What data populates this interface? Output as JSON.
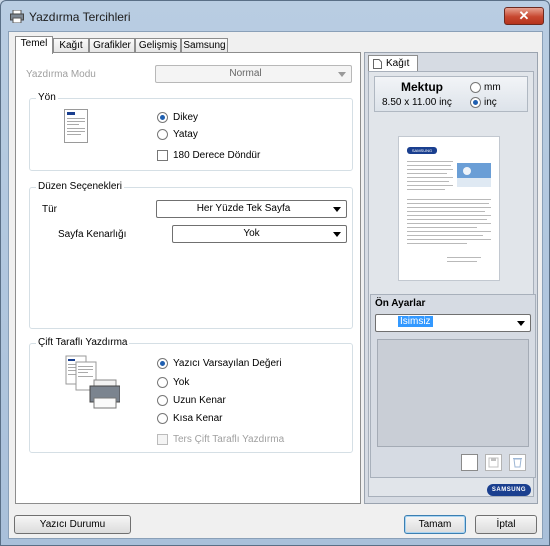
{
  "window": {
    "title": "Yazdırma Tercihleri",
    "close_glyph": "✕"
  },
  "tabs": [
    "Temel",
    "Kağıt",
    "Grafikler",
    "Gelişmiş",
    "Samsung"
  ],
  "basic": {
    "print_mode": {
      "label": "Yazdırma Modu",
      "value": "Normal"
    },
    "orientation": {
      "title": "Yön",
      "portrait": "Dikey",
      "landscape": "Yatay",
      "rotate": "180 Derece Döndür"
    },
    "layout": {
      "title": "Düzen Seçenekleri",
      "type_label": "Tür",
      "type_value": "Her Yüzde Tek Sayfa",
      "border_label": "Sayfa Kenarlığı",
      "border_value": "Yok"
    },
    "duplex": {
      "title": "Çift Taraflı Yazdırma",
      "printer_default": "Yazıcı Varsayılan Değeri",
      "none": "Yok",
      "long_edge": "Uzun Kenar",
      "short_edge": "Kısa Kenar",
      "reverse": "Ters Çift Taraflı Yazdırma"
    }
  },
  "preview": {
    "tab_label": "Kağıt",
    "paper_name": "Mektup",
    "paper_size": "8.50 x 11.00 inç",
    "unit_mm": "mm",
    "unit_inch": "inç",
    "page_logo": "SAMSUNG"
  },
  "favorites": {
    "title": "Ön Ayarlar",
    "value": "İsimsiz"
  },
  "brand": {
    "logo": "SAMSUNG"
  },
  "footer": {
    "printer_status": "Yazıcı Durumu",
    "ok": "Tamam",
    "cancel": "İptal"
  },
  "colors": {
    "accent": "#1f5fb0",
    "brand_blue": "#1a3f8f",
    "selection": "#3399ff"
  }
}
